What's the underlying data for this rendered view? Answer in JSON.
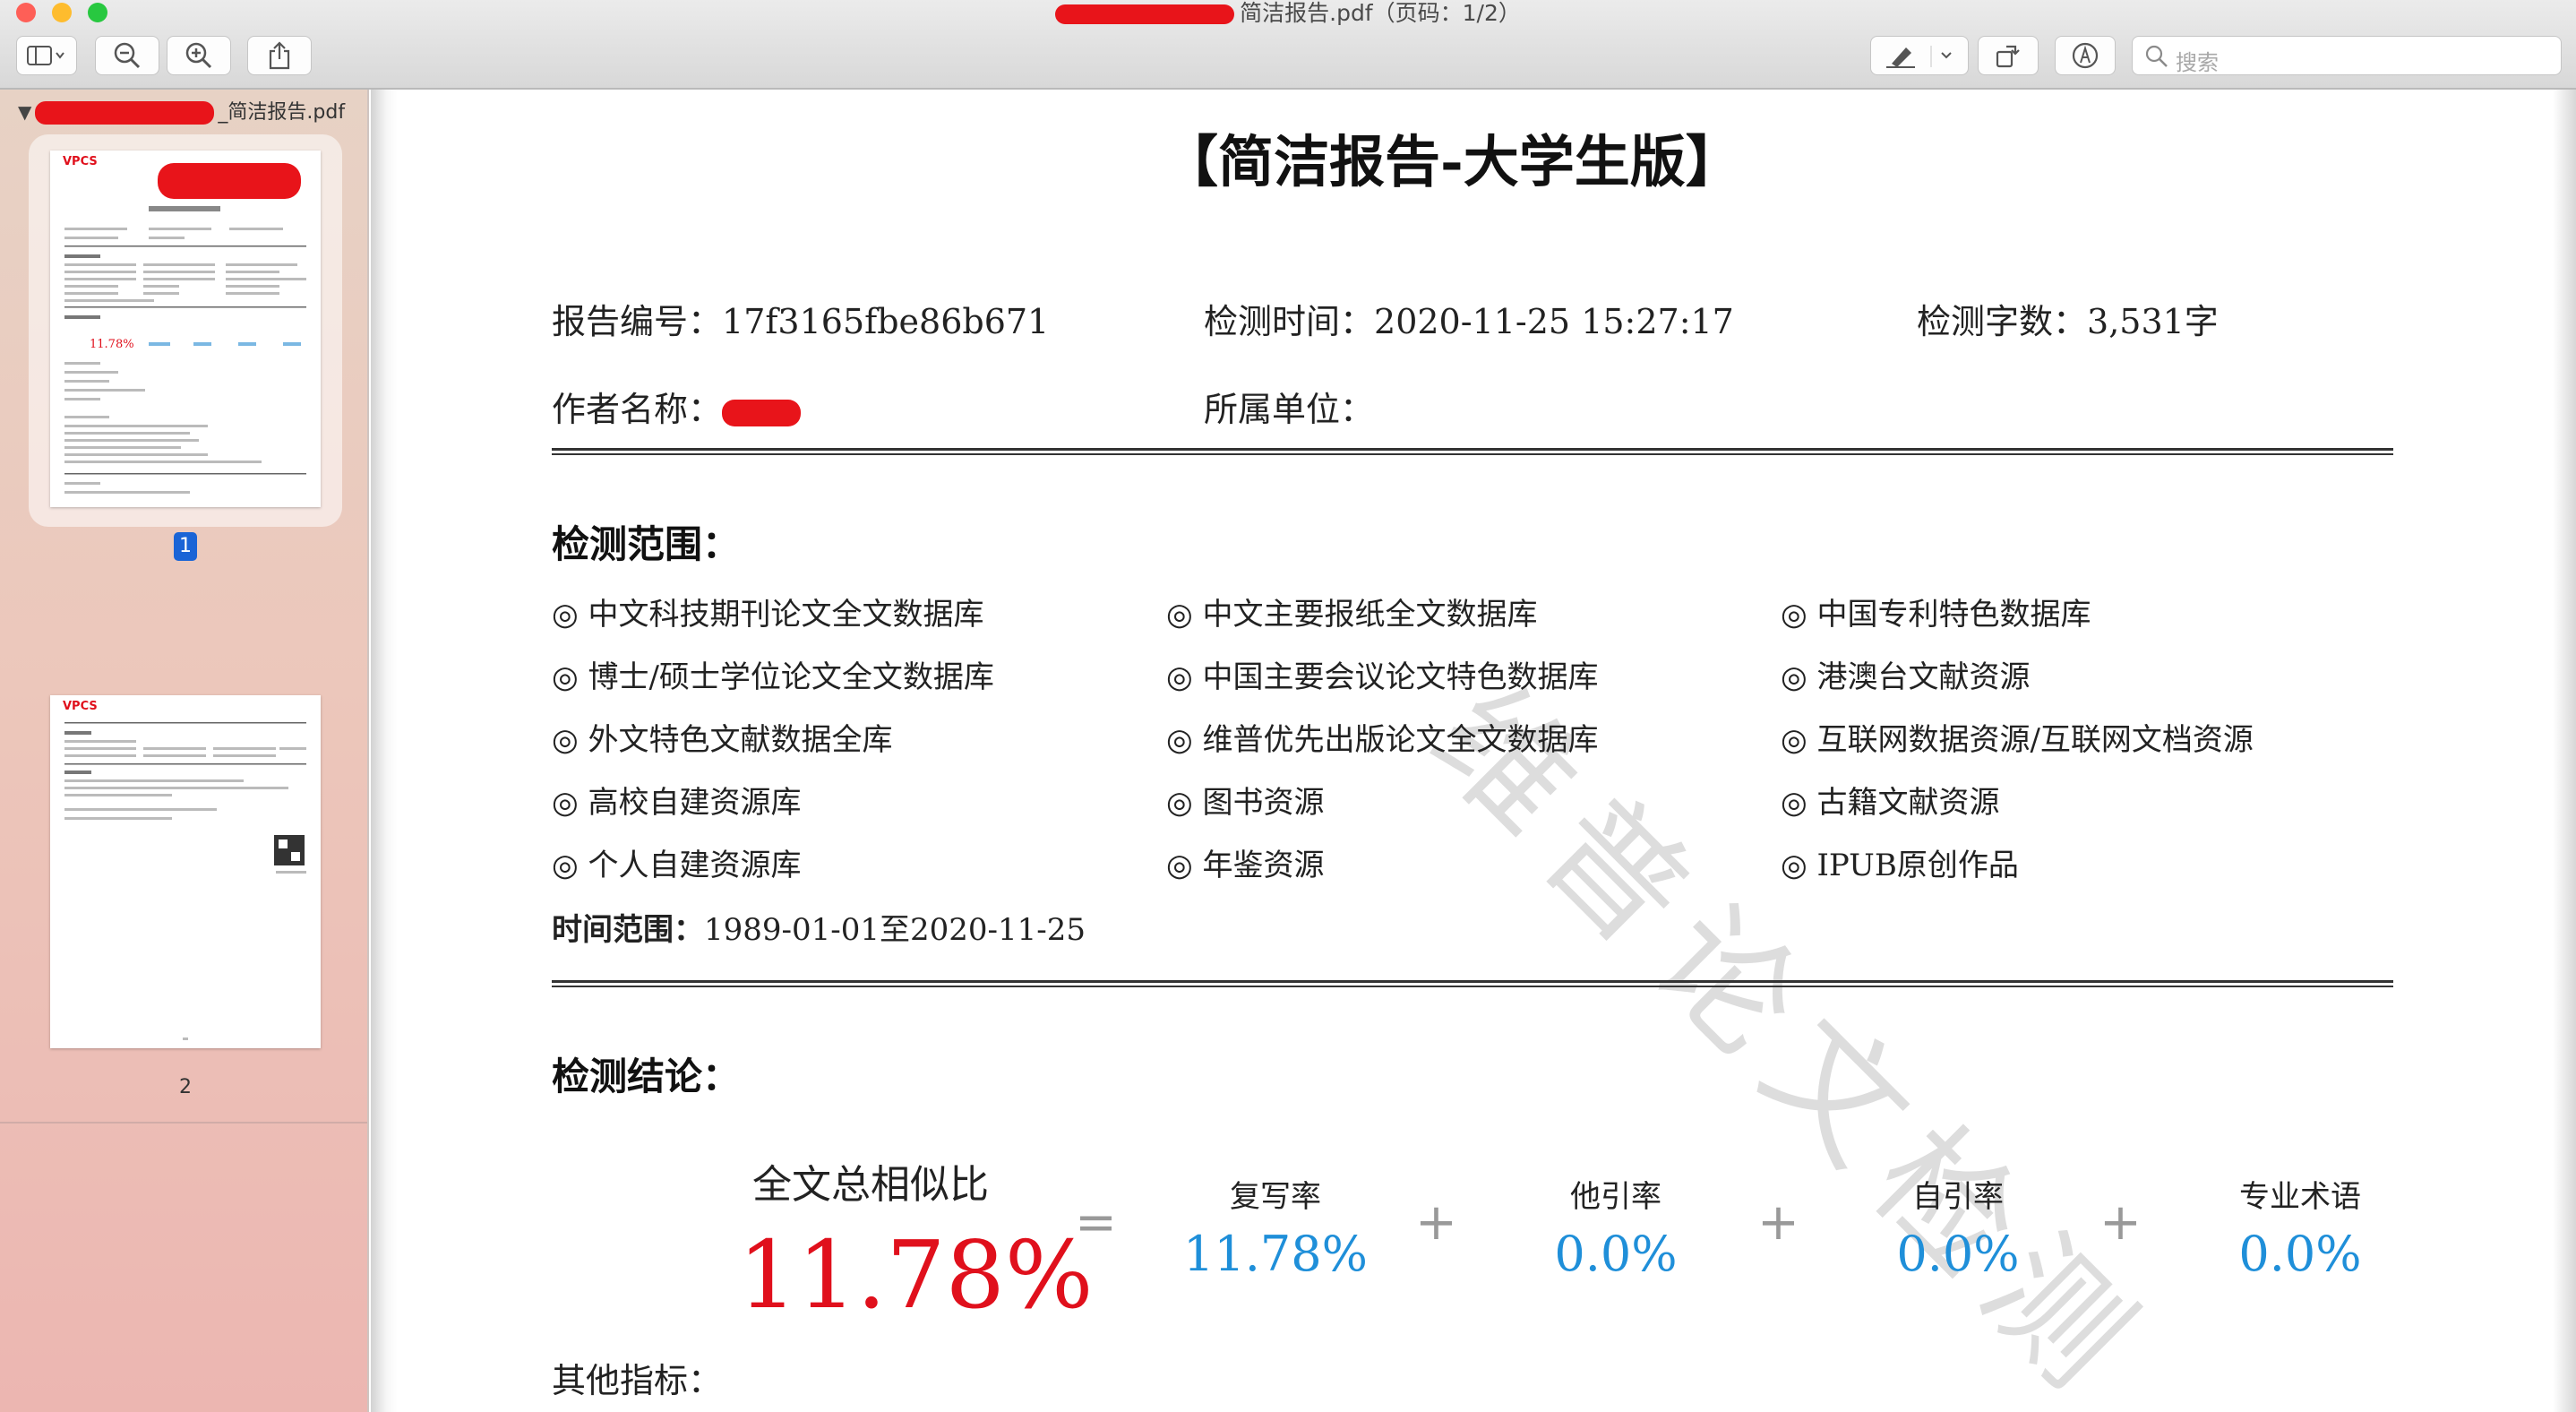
{
  "window": {
    "title": "简洁报告.pdf（页码：1/2）",
    "traffic_colors": {
      "close": "#fe5f57",
      "minimize": "#febc2e",
      "zoom": "#28c840"
    }
  },
  "toolbar": {
    "search_placeholder": "搜索"
  },
  "sidebar": {
    "file_name": "_简洁报告.pdf",
    "pages": [
      {
        "label": "1",
        "selected": true
      },
      {
        "label": "2",
        "selected": false
      }
    ],
    "thumb_brand": "VPCS"
  },
  "report": {
    "title": "【简洁报告-大学生版】",
    "report_no_label": "报告编号：",
    "report_no": "17f3165fbe86b671",
    "test_time_label": "检测时间：",
    "test_time": "2020-11-25 15:27:17",
    "word_count_label": "检测字数：",
    "word_count": "3,531字",
    "author_label": "作者名称：",
    "unit_label": "所属单位：",
    "scope_heading": "检测范围：",
    "databases": [
      "◎ 中文科技期刊论文全文数据库",
      "◎ 中文主要报纸全文数据库",
      "◎ 中国专利特色数据库",
      "◎ 博士/硕士学位论文全文数据库",
      "◎ 中国主要会议论文特色数据库",
      "◎ 港澳台文献资源",
      "◎ 外文特色文献数据全库",
      "◎ 维普优先出版论文全文数据库",
      "◎ 互联网数据资源/互联网文档资源",
      "◎ 高校自建资源库",
      "◎ 图书资源",
      "◎ 古籍文献资源",
      "◎ 个人自建资源库",
      "◎ 年鉴资源",
      "◎ IPUB原创作品"
    ],
    "time_range_label": "时间范围：",
    "time_range": "1989-01-01至2020-11-25",
    "conclusion_heading": "检测结论：",
    "total_label": "全文总相似比",
    "total_value": "11.78%",
    "equals": "=",
    "plus": "+",
    "metrics": [
      {
        "label": "复写率",
        "value": "11.78%"
      },
      {
        "label": "他引率",
        "value": "0.0%"
      },
      {
        "label": "自引率",
        "value": "0.0%"
      },
      {
        "label": "专业术语",
        "value": "0.0%"
      }
    ],
    "other_label": "其他指标：",
    "watermark": "维普论文检测",
    "accent_red": "#e0101c",
    "accent_blue": "#1f8fd9"
  }
}
